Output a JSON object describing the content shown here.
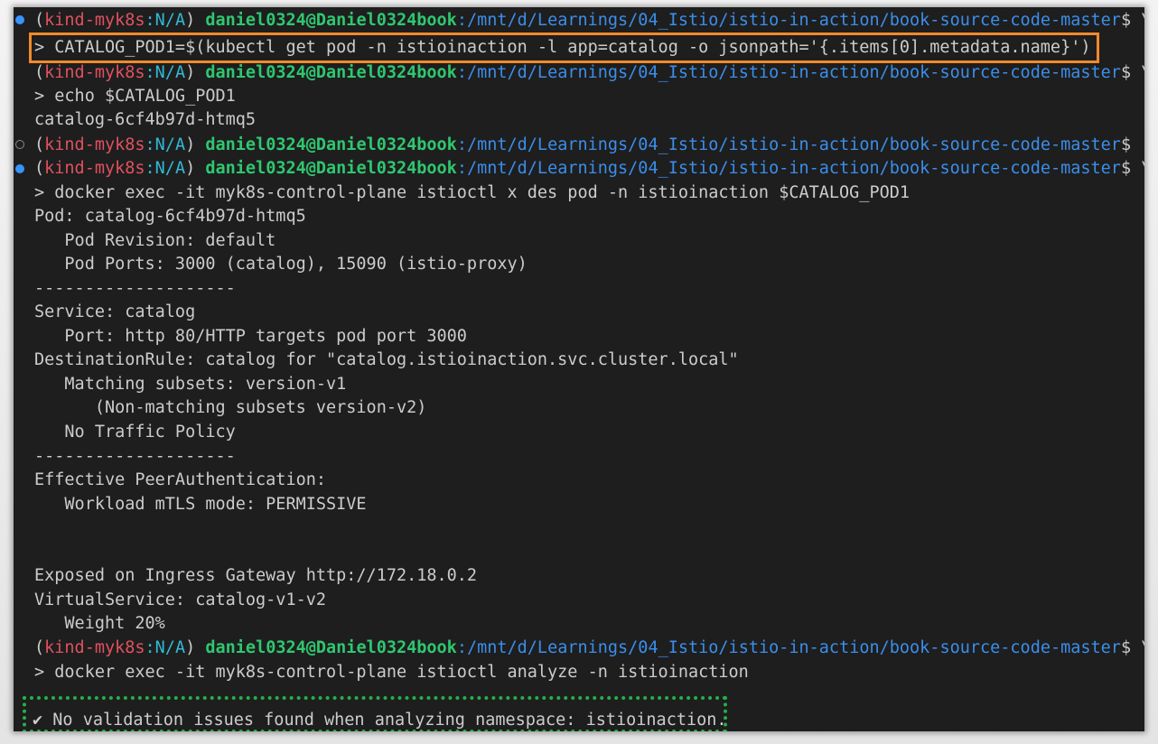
{
  "prompt": {
    "open_paren": "(",
    "context": "kind-myk8s",
    "colon": ":",
    "namespace": "N/A",
    "close_paren": ")",
    "user_host": "daniel0324@Daniel0324book",
    "path": ":/mnt/d/Learnings/04_Istio/istio-in-action/book-source-code-master",
    "dollar": "$",
    "continuation": " \\"
  },
  "colors": {
    "background": "#1e1e1e",
    "context": "#e0515f",
    "namespace": "#32b9d6",
    "user_host": "#2fc770",
    "path": "#3b8eea",
    "highlight_orange": "#f08a2c",
    "highlight_green": "#25b04a"
  },
  "lines": {
    "l2": "> CATALOG_POD1=$(kubectl get pod -n istioinaction -l app=catalog -o jsonpath='{.items[0].metadata.name}')",
    "l4": "> echo $CATALOG_POD1",
    "l5": "catalog-6cf4b97d-htmq5",
    "l8": "> docker exec -it myk8s-control-plane istioctl x des pod -n istioinaction $CATALOG_POD1",
    "l9": "Pod: catalog-6cf4b97d-htmq5",
    "l10": "   Pod Revision: default",
    "l11": "   Pod Ports: 3000 (catalog), 15090 (istio-proxy)",
    "l12": "--------------------",
    "l13": "Service: catalog",
    "l14": "   Port: http 80/HTTP targets pod port 3000",
    "l15": "DestinationRule: catalog for \"catalog.istioinaction.svc.cluster.local\"",
    "l16": "   Matching subsets: version-v1",
    "l17": "      (Non-matching subsets version-v2)",
    "l18": "   No Traffic Policy",
    "l19": "--------------------",
    "l20": "Effective PeerAuthentication:",
    "l21": "   Workload mTLS mode: PERMISSIVE",
    "l24": "Exposed on Ingress Gateway http://172.18.0.2",
    "l25": "VirtualService: catalog-v1-v2",
    "l26": "   Weight 20%",
    "l28": "> docker exec -it myk8s-control-plane istioctl analyze -n istioinaction",
    "l30": "✔ No validation issues found when analyzing namespace: istioinaction."
  }
}
